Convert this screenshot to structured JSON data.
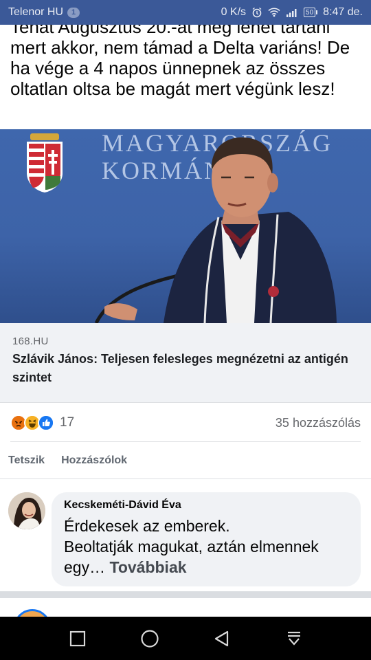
{
  "status_bar": {
    "carrier": "Telenor HU",
    "notification_count": "1",
    "speed": "0 K/s",
    "battery": "50",
    "time": "8:47 de."
  },
  "post": {
    "text": "Tehát Augusztus 20.-át még lehet tartani mert akkor, nem támad a Delta variáns! De ha vége a 4 napos ünnepnek az összes oltatlan oltsa be magát mert végünk lesz!"
  },
  "link_preview": {
    "image_text_line1": "MAGYARORSZÁG",
    "image_text_line2": "KORMÁNYA",
    "domain": "168.HU",
    "title": "Szlávik János: Teljesen felesleges megnézetni az antigén szintet"
  },
  "reactions": {
    "icons": [
      "angry-icon",
      "haha-icon",
      "like-icon"
    ],
    "count": "17",
    "comments": "35 hozzászólás"
  },
  "actions": {
    "like_label": "Tetszik",
    "comment_label": "Hozzászólok"
  },
  "comment": {
    "author": "Kecskeméti-Dávid Éva",
    "text_line1": "Érdekesek az emberek.",
    "text_line2": "Beoltatják magukat, aztán elmennek egy…",
    "more_label": "Továbbiak"
  },
  "colors": {
    "status_bar_bg": "#3b5998",
    "like_blue": "#1877f2",
    "angry_orange": "#e9710f",
    "haha_yellow": "#f7b125"
  }
}
